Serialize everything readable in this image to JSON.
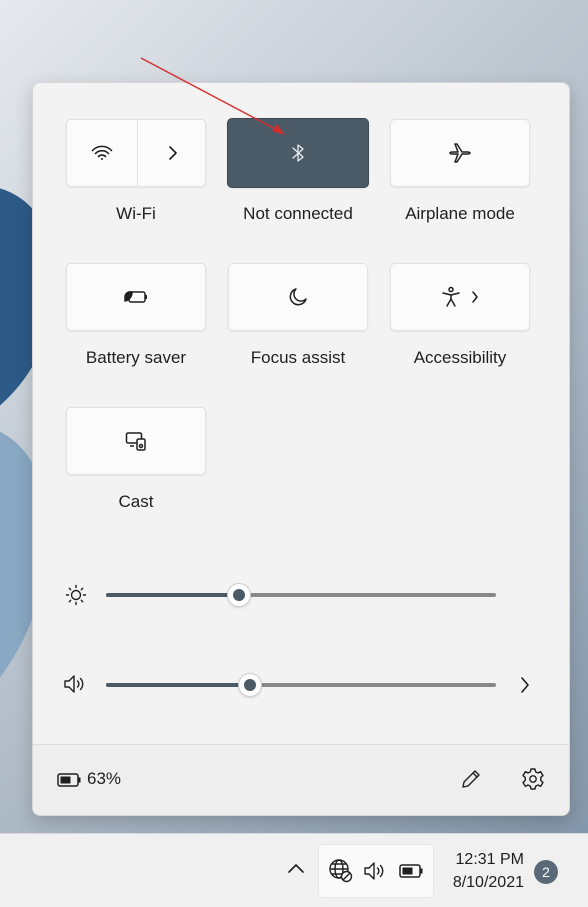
{
  "tiles": {
    "wifi": {
      "label": "Wi-Fi",
      "icon": "wifi-icon",
      "expand_icon": "chevron-right-icon"
    },
    "bluetooth": {
      "label": "Not connected",
      "icon": "bluetooth-icon",
      "state": "on",
      "accent": "#4b5a67"
    },
    "airplane": {
      "label": "Airplane mode",
      "icon": "airplane-icon"
    },
    "battery_saver": {
      "label": "Battery saver",
      "icon": "battery-saver-icon"
    },
    "focus_assist": {
      "label": "Focus assist",
      "icon": "moon-icon"
    },
    "accessibility": {
      "label": "Accessibility",
      "icon": "accessibility-icon",
      "expand_icon": "chevron-right-icon"
    },
    "cast": {
      "label": "Cast",
      "icon": "cast-icon"
    }
  },
  "sliders": {
    "brightness": {
      "icon": "sun-icon",
      "value_fraction": 0.34
    },
    "volume": {
      "icon": "speaker-icon",
      "value_fraction": 0.37,
      "expand_icon": "chevron-right-icon"
    }
  },
  "footer": {
    "battery_text": "63%",
    "battery_icon": "battery-icon",
    "edit_icon": "pencil-icon",
    "settings_icon": "gear-icon"
  },
  "taskbar": {
    "overflow_icon": "chevron-up-icon",
    "network_icon": "globe-no-internet-icon",
    "volume_icon": "speaker-icon",
    "battery_icon": "battery-icon",
    "time": "12:31 PM",
    "date": "8/10/2021",
    "notification_count": "2"
  },
  "colors": {
    "accent": "#4b5a67",
    "annotation_arrow": "#d32f2f"
  }
}
